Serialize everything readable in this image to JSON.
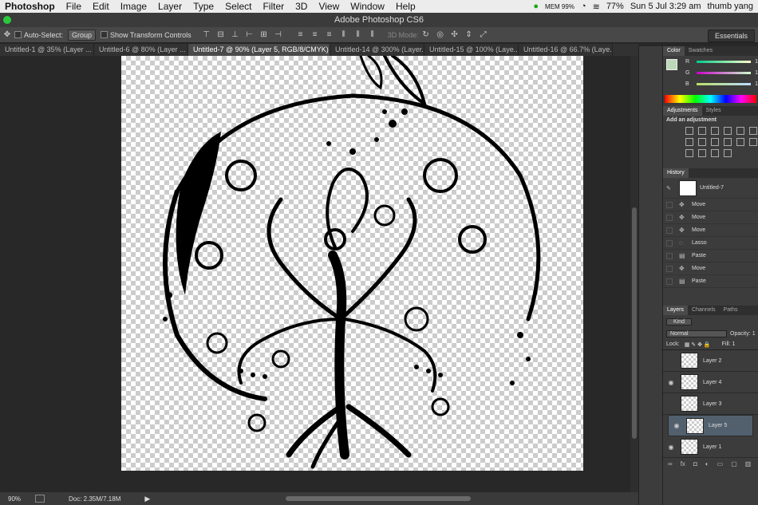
{
  "menubar": {
    "app": "Photoshop",
    "items": [
      "File",
      "Edit",
      "Image",
      "Layer",
      "Type",
      "Select",
      "Filter",
      "3D",
      "View",
      "Window",
      "Help"
    ],
    "mem": "MEM 99%",
    "battery": "77%",
    "datetime": "Sun 5 Jul  3:29 am",
    "user": "thumb yang"
  },
  "window": {
    "title": "Adobe Photoshop CS6"
  },
  "options": {
    "auto_select": "Auto-Select:",
    "group": "Group",
    "show_transform": "Show Transform Controls",
    "mode_3d": "3D Mode:",
    "workspace": "Essentials"
  },
  "tabs": [
    "Untitled-1 @ 35% (Layer ...",
    "Untitled-6 @ 80% (Layer ...",
    "Untitled-7 @ 90% (Layer 5, RGB/8/CMYK) *",
    "Untitled-14 @ 300% (Layer...",
    "Untitled-15 @ 100% (Laye...",
    "Untitled-16 @ 66.7% (Laye..."
  ],
  "status": {
    "zoom": "90%",
    "doc": "Doc: 2.35M/7.18M"
  },
  "color_panel": {
    "tabs": [
      "Color",
      "Swatches"
    ],
    "channels": [
      {
        "label": "R",
        "value": "1"
      },
      {
        "label": "G",
        "value": "1"
      },
      {
        "label": "B",
        "value": "1"
      }
    ]
  },
  "adjustments": {
    "tabs": [
      "Adjustments",
      "Styles"
    ],
    "heading": "Add an adjustment"
  },
  "history": {
    "tab": "History",
    "snapshot": "Untitled-7",
    "items": [
      "Move",
      "Move",
      "Move",
      "Lasso",
      "Paste",
      "Move",
      "Paste"
    ]
  },
  "layers": {
    "tabs": [
      "Layers",
      "Channels",
      "Paths"
    ],
    "kind": "Kind",
    "blend": "Normal",
    "opacity_label": "Opacity:",
    "opacity": "1",
    "lock_label": "Lock:",
    "fill_label": "Fill:",
    "fill": "1",
    "items": [
      {
        "name": "Layer 2",
        "visible": false
      },
      {
        "name": "Layer 4",
        "visible": true
      },
      {
        "name": "Layer 3",
        "visible": false
      },
      {
        "name": "Layer 5",
        "visible": true,
        "selected": true
      },
      {
        "name": "Layer 1",
        "visible": true
      }
    ]
  }
}
